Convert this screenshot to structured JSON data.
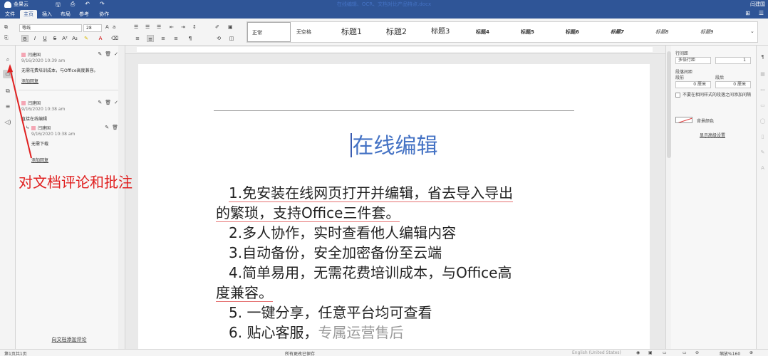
{
  "app": {
    "logo_text": "金果云",
    "doc_title": "在线编辑、OCR、文档对比产品特点.docx",
    "user": "闫建国"
  },
  "quick_access": [
    "🖫",
    "⎙",
    "↶",
    "↷"
  ],
  "tabs": [
    "文件",
    "主页",
    "插入",
    "布局",
    "参考",
    "协作"
  ],
  "active_tab": "主页",
  "ribbon": {
    "font_name": "等线",
    "font_size": "28",
    "styles": [
      "正常",
      "无空格",
      "标题1",
      "标题2",
      "标题3",
      "标题4",
      "标题5",
      "标题6",
      "标题7",
      "标题8",
      "标题9"
    ]
  },
  "comments_panel": {
    "comments": [
      {
        "author": "闫建国",
        "time": "9/16/2020 10:39 am",
        "text": "无需花费培训成本，与Office高度兼容。",
        "link": "添加回复"
      },
      {
        "author": "闫建国",
        "time": "9/16/2020 10:38 am",
        "text": "直接在线编辑",
        "reply": {
          "author": "闫建国",
          "time": "9/16/2020 10:38 am",
          "text": "无需下载"
        },
        "link": "添加回复"
      }
    ],
    "add_comment": "向文档添加评论"
  },
  "annotation": {
    "text": "对文档评论和批注",
    "color": "#e02020"
  },
  "document": {
    "title": "在线编辑",
    "title_color": "#4472c4",
    "lines": [
      "1.免安装在线网页打开并编辑，省去导入导出",
      "的繁琐，支持Office三件套。",
      "2.多人协作，实时查看他人编辑内容",
      "3.自动备份，安全加密备份至云端",
      "4.简单易用，无需花费培训成本，与Office高",
      "度兼容。",
      "5. 一键分享，任意平台均可查看",
      "6. 贴心客服，",
      "专属运营售后"
    ]
  },
  "right_panel": {
    "line_spacing_label": "行间距",
    "line_spacing_value": "多倍行距",
    "line_spacing_num": "1",
    "para_spacing_label": "段落间距",
    "before_label": "段前",
    "after_label": "段后",
    "before_value": "0 厘米",
    "after_value": "0 厘米",
    "checkbox_label": "不要在相同样式的段落之间添加间隔",
    "bg_color_label": "背景颜色",
    "advanced_link": "显示高级设置"
  },
  "status": {
    "page": "第1页共1页",
    "save_state": "所有更改已保存",
    "language": "English (United States)",
    "zoom": "缩放%160"
  }
}
